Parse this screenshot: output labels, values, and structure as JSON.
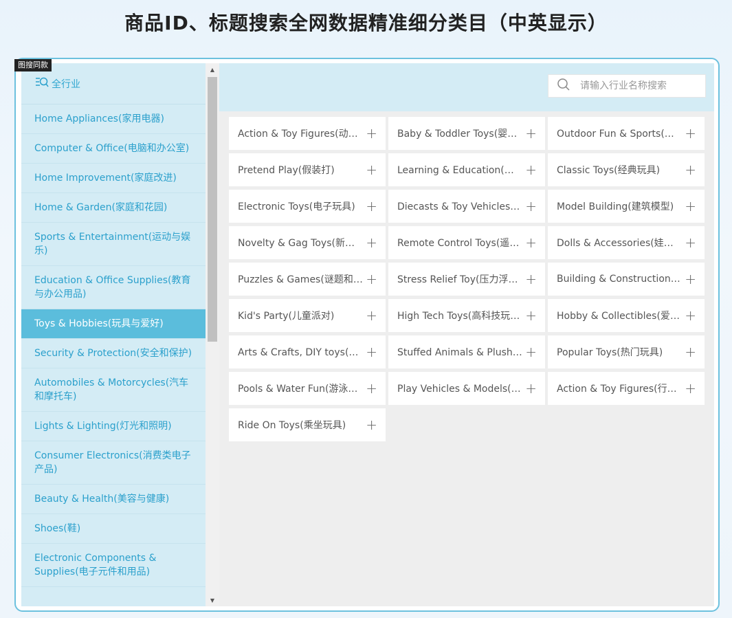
{
  "title": "商品ID、标题搜索全网数据精准细分类目（中英显示）",
  "tag": "图搜同款",
  "sidebar": {
    "header": "全行业",
    "items": [
      {
        "label": "Home Appliances(家用电器)"
      },
      {
        "label": "Computer & Office(电脑和办公室)"
      },
      {
        "label": "Home Improvement(家庭改进)"
      },
      {
        "label": "Home & Garden(家庭和花园)"
      },
      {
        "label": "Sports & Entertainment(运动与娱乐)"
      },
      {
        "label": "Education & Office Supplies(教育与办公用品)"
      },
      {
        "label": "Toys & Hobbies(玩具与爱好)",
        "active": true
      },
      {
        "label": "Security & Protection(安全和保护)"
      },
      {
        "label": "Automobiles & Motorcycles(汽车和摩托车)"
      },
      {
        "label": "Lights & Lighting(灯光和照明)"
      },
      {
        "label": "Consumer Electronics(消费类电子产品)"
      },
      {
        "label": "Beauty & Health(美容与健康)"
      },
      {
        "label": "Shoes(鞋)"
      },
      {
        "label": "Electronic Components & Supplies(电子元件和用品)"
      }
    ]
  },
  "search": {
    "placeholder": "请输入行业名称搜索",
    "value": ""
  },
  "categories": [
    {
      "label": "Action & Toy Figures(动漫玩具)"
    },
    {
      "label": "Baby & Toddler Toys(婴幼儿玩具)"
    },
    {
      "label": "Outdoor Fun & Sports(户外运动)"
    },
    {
      "label": "Pretend Play(假装打)"
    },
    {
      "label": "Learning & Education(学习与教育)"
    },
    {
      "label": "Classic Toys(经典玩具)"
    },
    {
      "label": "Electronic Toys(电子玩具)"
    },
    {
      "label": "Diecasts & Toy Vehicles(压铸和玩具车)"
    },
    {
      "label": "Model Building(建筑模型)"
    },
    {
      "label": "Novelty & Gag Toys(新奇玩具)"
    },
    {
      "label": "Remote Control Toys(遥控玩具)"
    },
    {
      "label": "Dolls & Accessories(娃娃和配件)"
    },
    {
      "label": "Puzzles & Games(谜题和游戏)"
    },
    {
      "label": "Stress Relief Toy(压力浮雕玩具)"
    },
    {
      "label": "Building & Construction Toys"
    },
    {
      "label": "Kid's Party(儿童派对)"
    },
    {
      "label": "High Tech Toys(高科技玩具)"
    },
    {
      "label": "Hobby & Collectibles(爱好与收藏)"
    },
    {
      "label": "Arts & Crafts, DIY toys(工艺品)"
    },
    {
      "label": "Stuffed Animals & Plush(毛绒玩具)"
    },
    {
      "label": "Popular Toys(热门玩具)"
    },
    {
      "label": "Pools & Water Fun(游泳池和水上乐趣)"
    },
    {
      "label": "Play Vehicles & Models(游戏车和模型)"
    },
    {
      "label": "Action & Toy Figures(行动和玩具人物)"
    },
    {
      "label": "Ride On Toys(乘坐玩具)"
    }
  ],
  "plus_symbol": "+",
  "icons": {
    "menu_search": "list-search-icon",
    "search": "search-icon",
    "scroll_up": "scroll-up-arrow-icon",
    "scroll_down": "scroll-down-arrow-icon",
    "add": "plus-icon"
  },
  "colors": {
    "accent": "#2ba0cc",
    "active_bg": "#5bbddc",
    "panel_bg": "#d4ecf5",
    "grid_bg": "#eeeeee",
    "frame_border": "#6cc1de"
  }
}
